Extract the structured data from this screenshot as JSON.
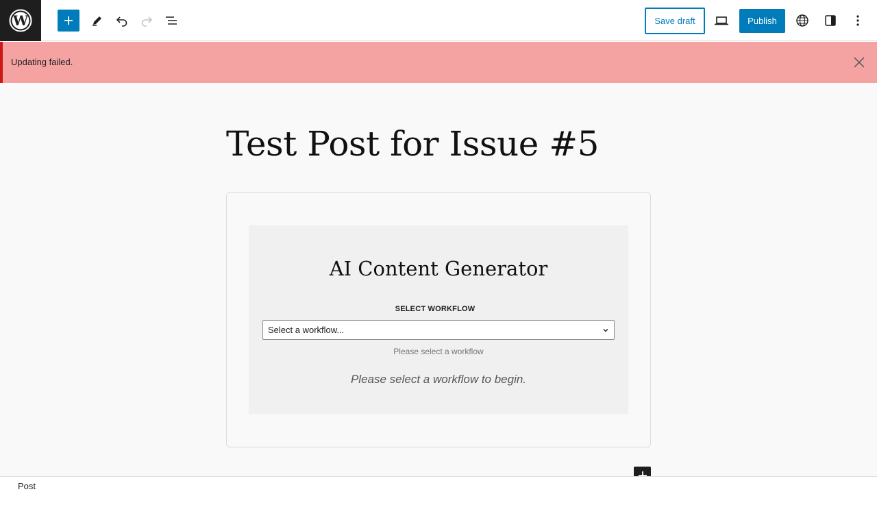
{
  "toolbar": {
    "logo_icon": "wordpress-logo",
    "add_block_icon": "plus-icon",
    "tools_icon": "pencil-icon",
    "undo_icon": "undo-icon",
    "redo_icon": "redo-icon",
    "document_overview_icon": "list-view-icon",
    "save_draft_label": "Save draft",
    "preview_icon": "laptop-icon",
    "publish_label": "Publish",
    "language_icon": "globe-icon",
    "settings_icon": "sidebar-icon",
    "options_icon": "more-vertical-icon",
    "accent_color": "#007cba"
  },
  "notice": {
    "text": "Updating failed.",
    "close_icon": "close-icon",
    "background_color": "#f4a2a2",
    "border_color": "#cc1818"
  },
  "editor": {
    "post_title": "Test Post for Issue #5",
    "block": {
      "title": "AI Content Generator",
      "workflow_label": "SELECT WORKFLOW",
      "workflow_select_value": "Select a workflow...",
      "workflow_help": "Please select a workflow",
      "begin_message": "Please select a workflow to begin."
    },
    "inserter_icon": "plus-icon"
  },
  "footer": {
    "breadcrumb": "Post"
  }
}
